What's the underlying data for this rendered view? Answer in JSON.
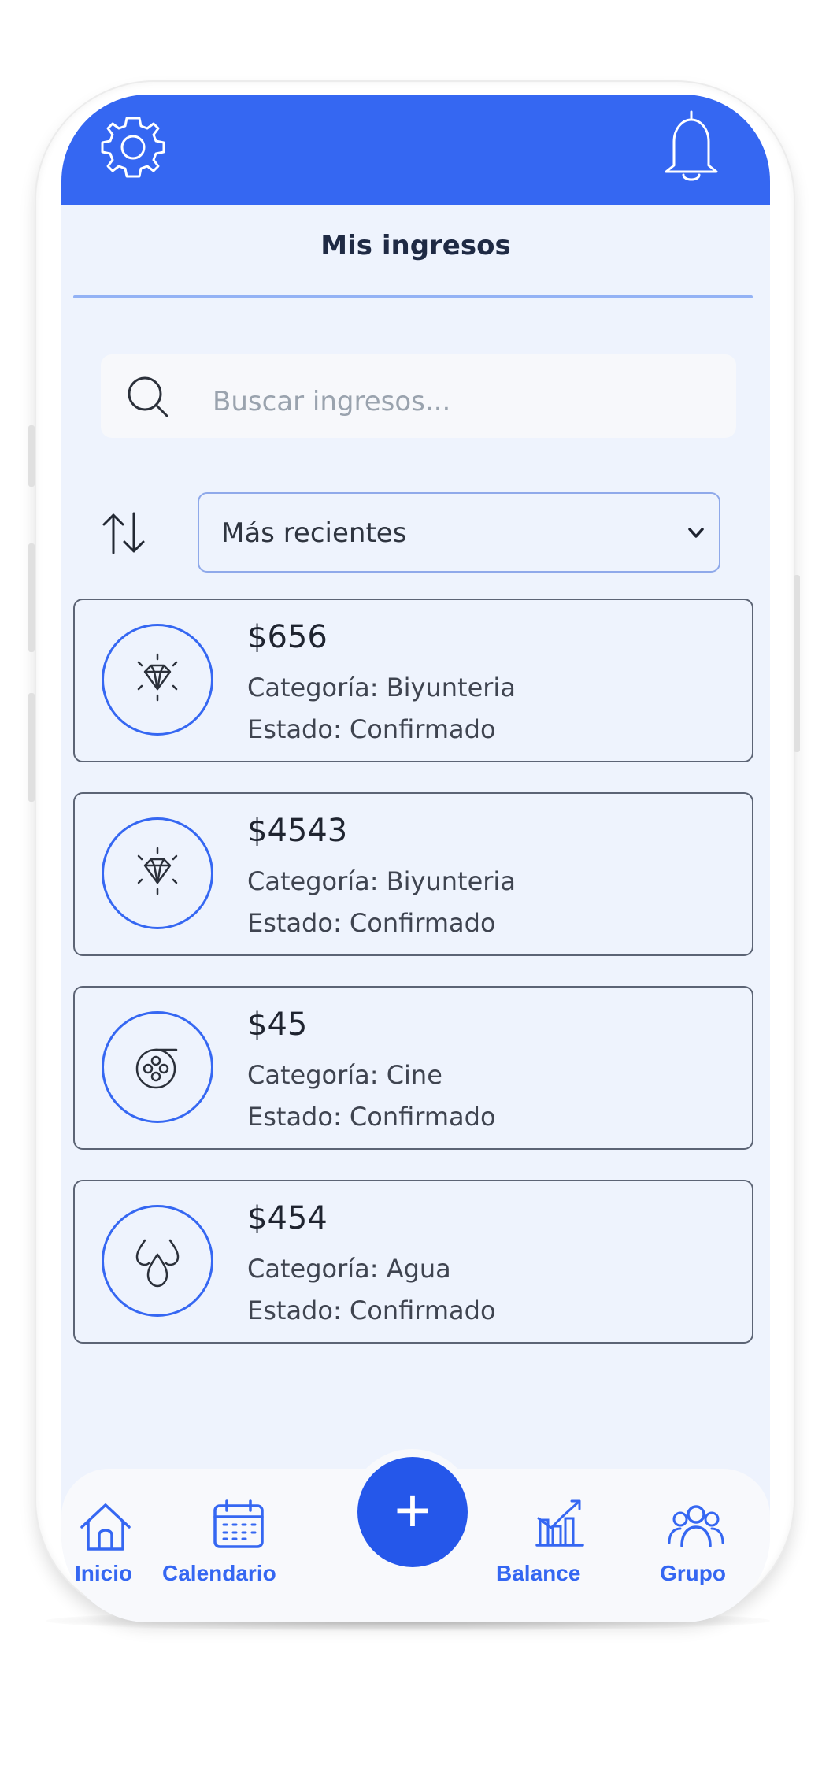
{
  "header": {
    "title": "Mis ingresos",
    "settings_icon": "gear-icon",
    "notifications_icon": "bell-icon"
  },
  "search": {
    "placeholder": "Buscar ingresos...",
    "icon": "search-icon"
  },
  "sort": {
    "icon": "sort-arrows-icon",
    "selected": "Más recientes"
  },
  "incomes": [
    {
      "amount": "$656",
      "category": "Categoría: Biyunteria",
      "status": "Estado: Confirmado",
      "icon": "diamond-icon"
    },
    {
      "amount": "$4543",
      "category": "Categoría: Biyunteria",
      "status": "Estado: Confirmado",
      "icon": "diamond-icon"
    },
    {
      "amount": "$45",
      "category": "Categoría: Cine",
      "status": "Estado: Confirmado",
      "icon": "film-reel-icon"
    },
    {
      "amount": "$454",
      "category": "Categoría: Agua",
      "status": "Estado: Confirmado",
      "icon": "water-drops-icon"
    }
  ],
  "nav": {
    "items": [
      {
        "label": "Inicio",
        "icon": "home-icon"
      },
      {
        "label": "Calendario",
        "icon": "calendar-icon"
      },
      {
        "label": "Balance",
        "icon": "chart-icon"
      },
      {
        "label": "Grupo",
        "icon": "group-icon"
      }
    ],
    "add_label": "+"
  },
  "colors": {
    "accent": "#3567f2",
    "background": "#eef3fd",
    "text": "#1f2a44"
  }
}
